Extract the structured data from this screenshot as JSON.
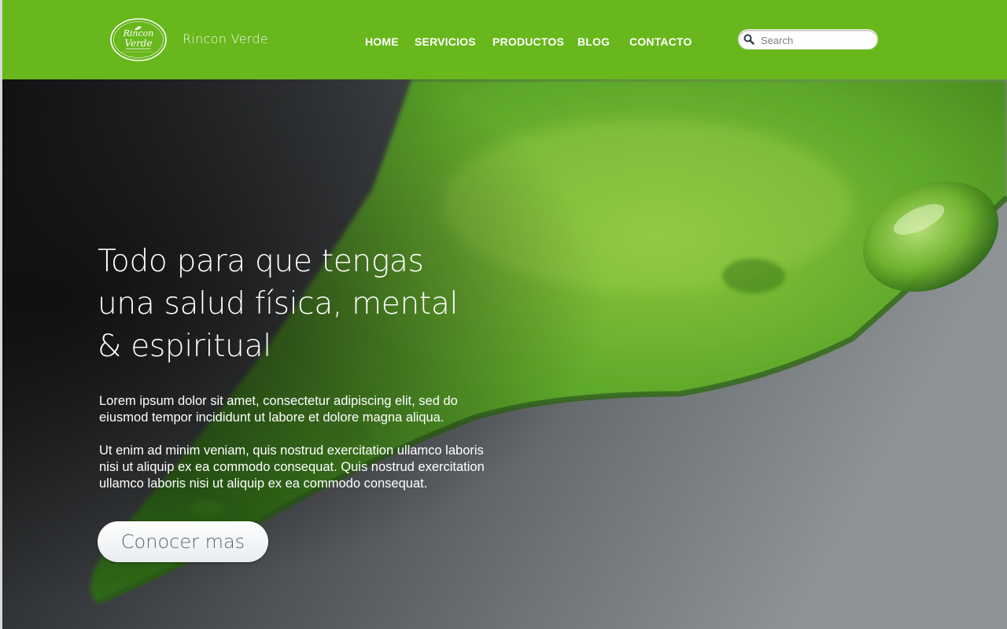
{
  "brand": {
    "name": "Rincon Verde",
    "logo_text_top": "Rincon",
    "logo_text_bottom": "Verde"
  },
  "nav": {
    "items": [
      "HOME",
      "SERVICIOS",
      "PRODUCTOS",
      "BLOG",
      "CONTACTO"
    ]
  },
  "search": {
    "placeholder": "Search",
    "icon": "search-icon"
  },
  "hero": {
    "headline": [
      "Todo para que tengas",
      "una salud física, mental",
      "& espiritual"
    ],
    "paragraph1": "Lorem ipsum dolor sit amet, consectetur adipiscing elit, sed do eiusmod tempor incididunt ut labore et dolore magna aliqua.",
    "paragraph2": "Ut enim ad minim veniam, quis nostrud exercitation ullamco laboris nisi ut aliquip ex ea commodo consequat. Quis nostrud exercitation ullamco laboris nisi ut aliquip ex ea commodo consequat.",
    "cta_label": "Conocer mas"
  },
  "colors": {
    "header_green": "#68b71c",
    "leaf_green": "#5aa82a",
    "button_text": "#5a6673"
  }
}
